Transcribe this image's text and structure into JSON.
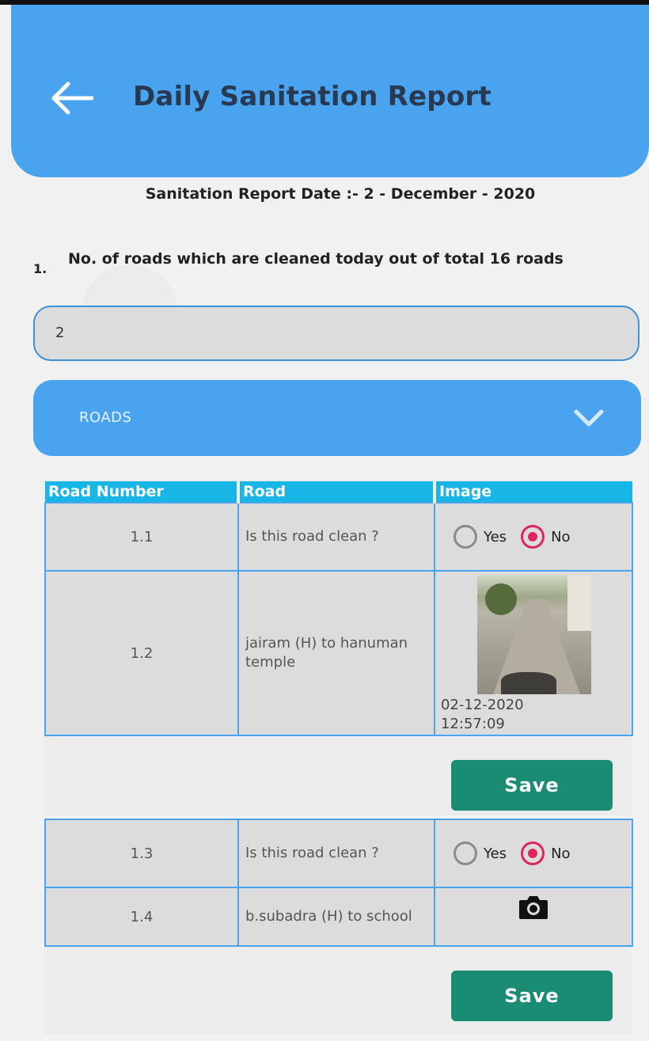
{
  "header": {
    "title": "Daily Sanitation Report"
  },
  "report_date_text": "Sanitation Report Date :- 2 - December - 2020",
  "question": {
    "number": "1.",
    "text": "No. of roads which are cleaned today out of total 16 roads"
  },
  "count_input": {
    "value": "2"
  },
  "roads_dropdown": {
    "label": "ROADS"
  },
  "table": {
    "headers": [
      "Road Number",
      "Road",
      "Image"
    ],
    "rows": [
      {
        "number": "1.1",
        "road": "Is this road clean ?",
        "option_yes": "Yes",
        "option_no": "No",
        "selected": "No"
      },
      {
        "number": "1.2",
        "road": "jairam (H) to hanuman temple",
        "image_date": "02-12-2020",
        "image_time": "12:57:09"
      },
      {
        "number": "1.3",
        "road": "Is this road clean ?",
        "option_yes": "Yes",
        "option_no": "No",
        "selected": "No"
      },
      {
        "number": "1.4",
        "road": "b.subadra (H) to school"
      }
    ]
  },
  "buttons": {
    "save_1": "Save",
    "save_2": "Save"
  },
  "icons": {
    "back": "arrow-left-icon",
    "chevron": "chevron-down-icon",
    "camera": "camera-icon"
  },
  "colors": {
    "header": "#4aa3ef",
    "table_header": "#17b6e6",
    "save": "#1a8c74",
    "radio_selected": "#e0245e"
  }
}
